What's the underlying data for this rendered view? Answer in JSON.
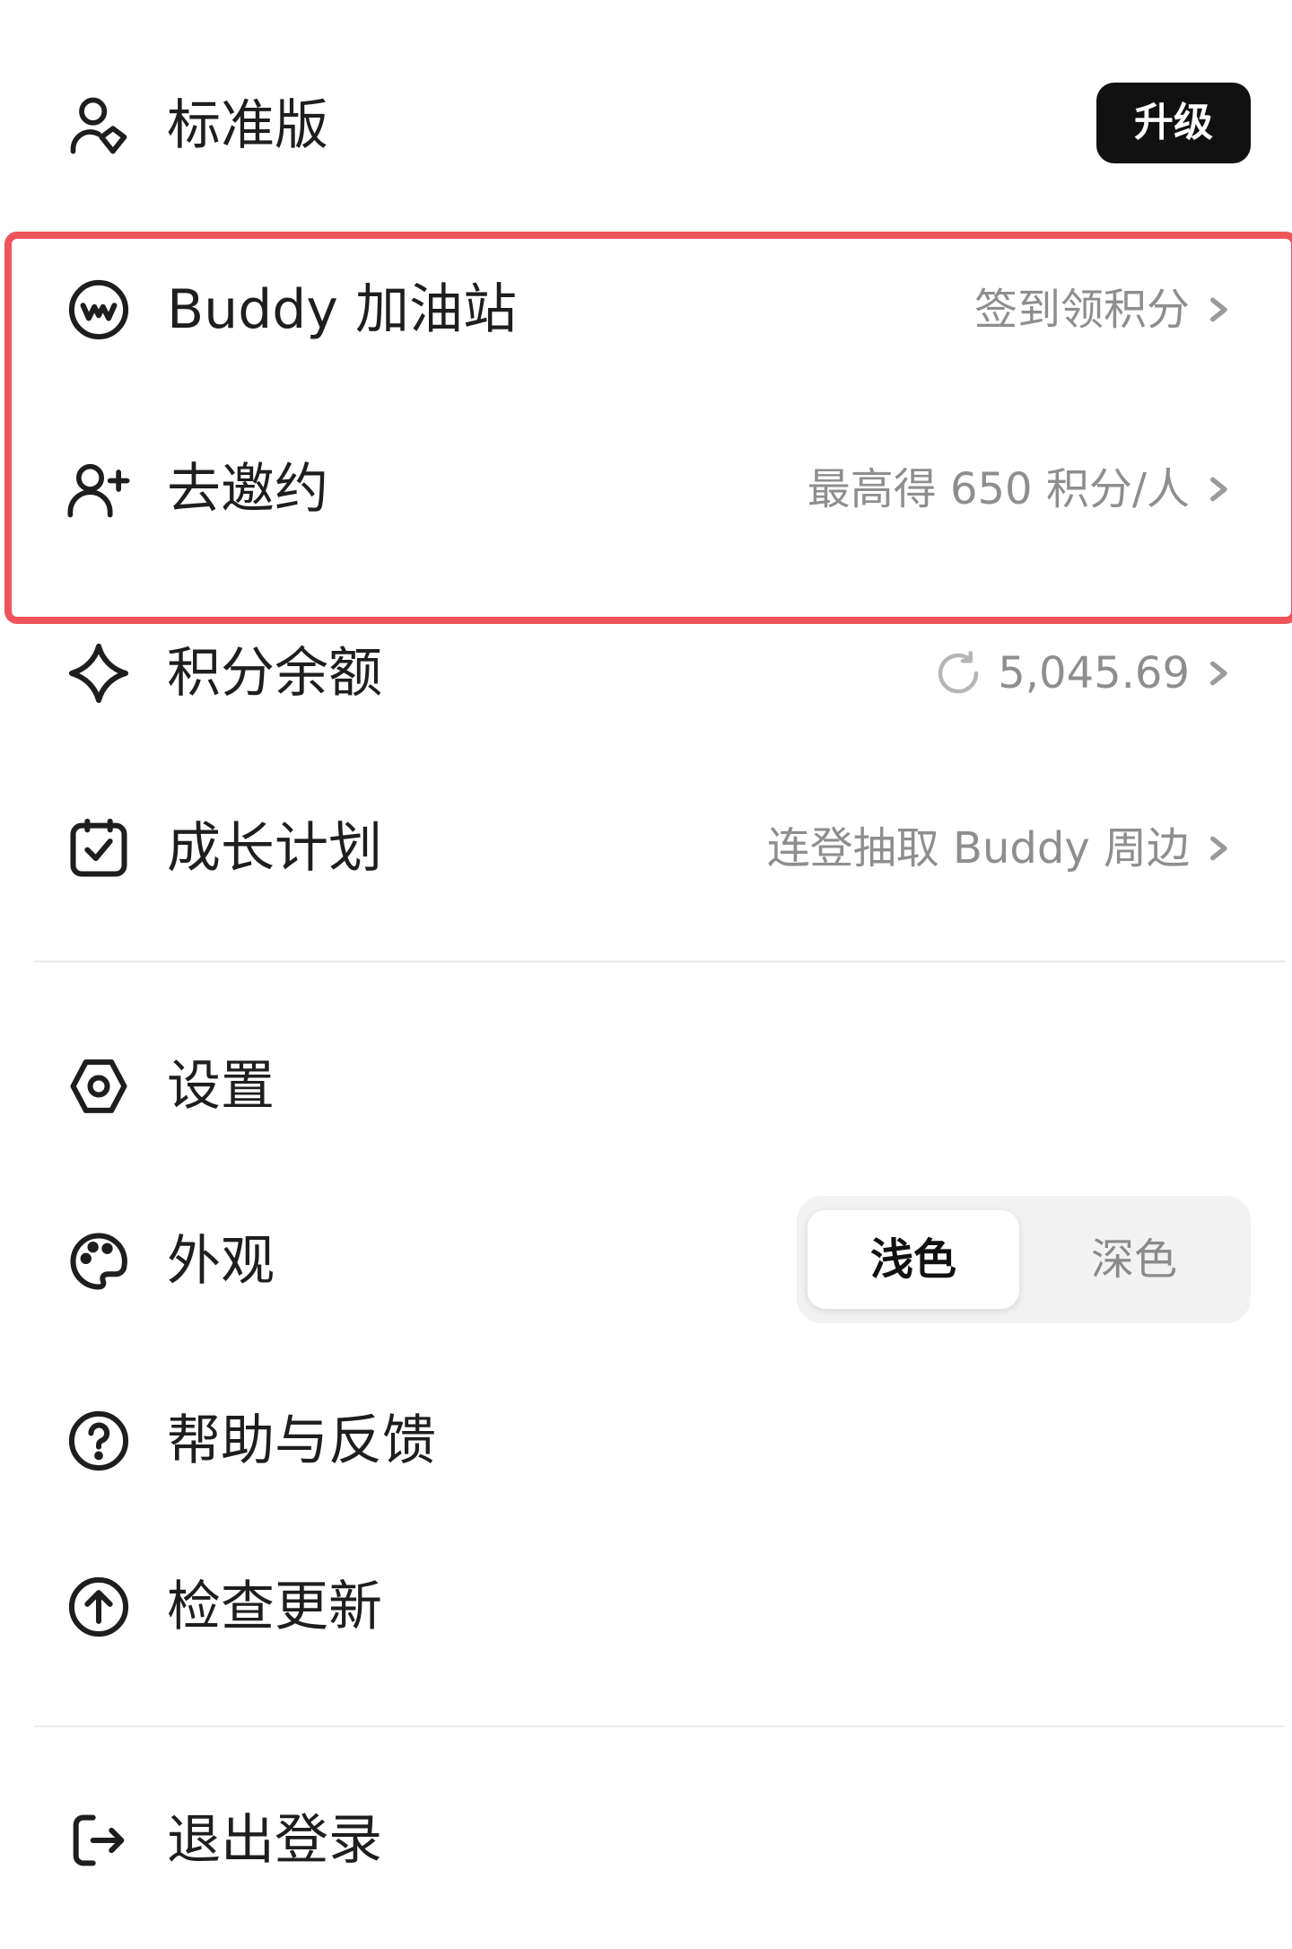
{
  "plan": {
    "label": "标准版",
    "upgrade_label": "升级"
  },
  "buddy_station": {
    "label": "Buddy 加油站",
    "value": "签到领积分"
  },
  "invite": {
    "label": "去邀约",
    "value": "最高得 650 积分/人"
  },
  "points": {
    "label": "积分余额",
    "value": "5,045.69"
  },
  "growth": {
    "label": "成长计划",
    "value": "连登抽取 Buddy 周边"
  },
  "settings": {
    "label": "设置"
  },
  "appearance": {
    "label": "外观",
    "light_label": "浅色",
    "dark_label": "深色",
    "selected": "浅色"
  },
  "help": {
    "label": "帮助与反馈"
  },
  "update": {
    "label": "检查更新"
  },
  "logout": {
    "label": "退出登录"
  },
  "colors": {
    "highlight_border": "#f0545b",
    "upgrade_bg": "#111111",
    "muted_text": "#8e8e8e"
  },
  "icons": [
    "user-shield-icon",
    "buddy-logo-icon",
    "add-user-icon",
    "diamond-icon",
    "calendar-check-icon",
    "settings-icon",
    "palette-icon",
    "help-icon",
    "upload-icon",
    "logout-icon",
    "refresh-icon",
    "chevron-right-icon"
  ]
}
